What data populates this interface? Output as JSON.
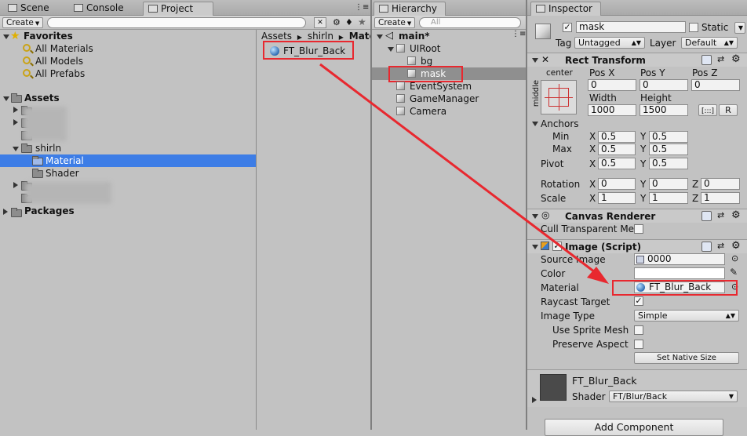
{
  "project_panel": {
    "tabs": [
      {
        "label": "Scene"
      },
      {
        "label": "Console"
      },
      {
        "label": "Project"
      }
    ],
    "create_label": "Create",
    "favorites_label": "Favorites",
    "favorites": [
      "All Materials",
      "All Models",
      "All Prefabs"
    ],
    "assets_label": "Assets",
    "tree": [
      {
        "label": ""
      },
      {
        "label": ""
      },
      {
        "label": ""
      },
      {
        "label": "shirln"
      },
      {
        "label": "Material"
      },
      {
        "label": "Shader"
      },
      {
        "label": ""
      },
      {
        "label": ""
      }
    ],
    "packages_label": "Packages",
    "breadcrumb": [
      "Assets",
      "shirln",
      "Mate"
    ],
    "file_item": "FT_Blur_Back"
  },
  "hierarchy_panel": {
    "tab_label": "Hierarchy",
    "create_label": "Create",
    "search_placeholder": "All",
    "scene_name": "main*",
    "items": [
      {
        "label": "UIRoot"
      },
      {
        "label": "bg"
      },
      {
        "label": "mask"
      },
      {
        "label": "EventSystem"
      },
      {
        "label": "GameManager"
      },
      {
        "label": "Camera"
      }
    ]
  },
  "inspector": {
    "tab_label": "Inspector",
    "object_name": "mask",
    "static_label": "Static",
    "tag_label": "Tag",
    "tag_value": "Untagged",
    "layer_label": "Layer",
    "layer_value": "Default",
    "rect_transform": {
      "title": "Rect Transform",
      "anchor_preset_top": "center",
      "anchor_preset_side": "middle",
      "pos_x_label": "Pos X",
      "pos_y_label": "Pos Y",
      "pos_z_label": "Pos Z",
      "pos_x": "0",
      "pos_y": "0",
      "pos_z": "0",
      "width_label": "Width",
      "height_label": "Height",
      "width": "1000",
      "height": "1500",
      "r_button": "R",
      "anchors_label": "Anchors",
      "min_label": "Min",
      "max_label": "Max",
      "pivot_label": "Pivot",
      "x_label": "X",
      "y_label": "Y",
      "z_label": "Z",
      "min_x": "0.5",
      "min_y": "0.5",
      "max_x": "0.5",
      "max_y": "0.5",
      "pivot_x": "0.5",
      "pivot_y": "0.5",
      "rotation_label": "Rotation",
      "rot_x": "0",
      "rot_y": "0",
      "rot_z": "0",
      "scale_label": "Scale",
      "scale_x": "1",
      "scale_y": "1",
      "scale_z": "1"
    },
    "canvas_renderer": {
      "title": "Canvas Renderer",
      "cull_label": "Cull Transparent Me"
    },
    "image": {
      "title": "Image (Script)",
      "source_label": "Source Image",
      "source_value": "0000",
      "color_label": "Color",
      "material_label": "Material",
      "material_value": "FT_Blur_Back",
      "raycast_label": "Raycast Target",
      "image_type_label": "Image Type",
      "image_type_value": "Simple",
      "use_sprite_mesh_label": "Use Sprite Mesh",
      "preserve_aspect_label": "Preserve Aspect",
      "native_size_button": "Set Native Size"
    },
    "material_preview": {
      "name": "FT_Blur_Back",
      "shader_label": "Shader",
      "shader_value": "FT/Blur/Back"
    },
    "add_component": "Add Component"
  },
  "colors": {
    "selection": "#3d7de6",
    "highlight": "#e8282f",
    "panel_bg": "#c2c2c2"
  }
}
